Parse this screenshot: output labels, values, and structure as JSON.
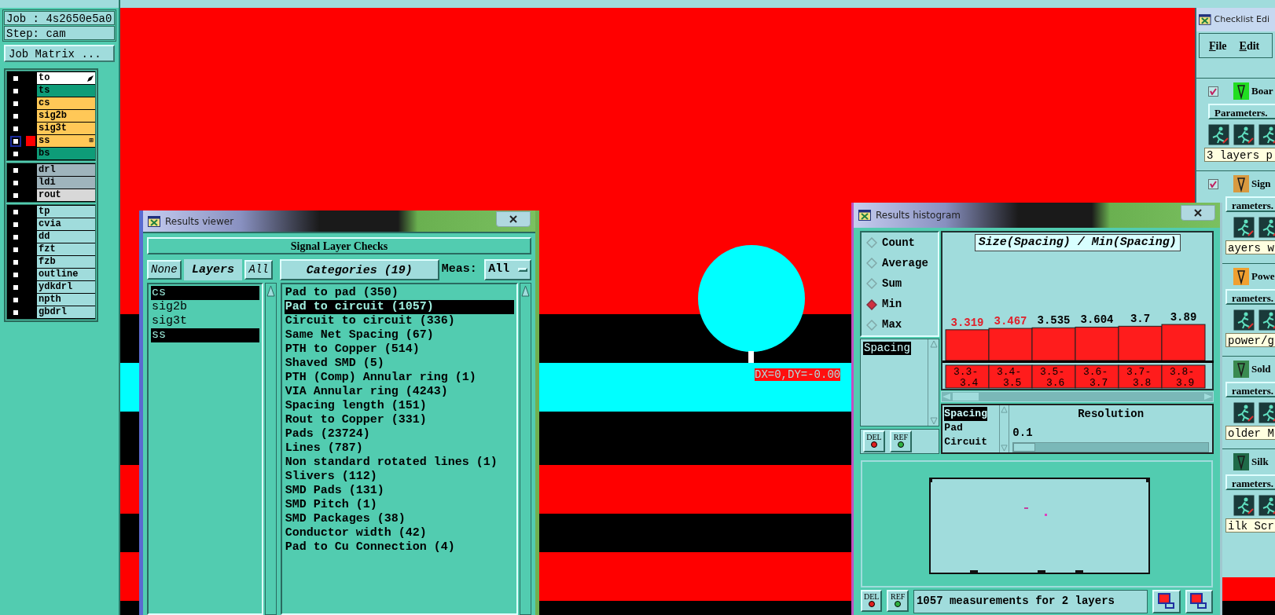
{
  "canvas": {
    "readout": "DX=0,DY=-0.00"
  },
  "job_panel": {
    "job": "Job : 4s2650e5a0",
    "step": "Step: cam",
    "matrix_button": "Job Matrix ...",
    "layer_groups": [
      {
        "layers": [
          {
            "name": "to",
            "color": "#ffffff",
            "checked": false,
            "active": false,
            "work_layer": true
          },
          {
            "name": "ts",
            "color": "#0e9c78",
            "checked": false,
            "active": false,
            "work_layer": false
          },
          {
            "name": "cs",
            "color": "#ffc857",
            "checked": false,
            "active": false,
            "work_layer": false
          },
          {
            "name": "sig2b",
            "color": "#ffc857",
            "checked": false,
            "active": false,
            "work_layer": false
          },
          {
            "name": "sig3t",
            "color": "#ffc857",
            "checked": false,
            "active": false,
            "work_layer": false
          },
          {
            "name": "ss",
            "color": "#ffc857",
            "checked": false,
            "active": true,
            "work_layer": false,
            "marker": "⊞"
          },
          {
            "name": "bs",
            "color": "#0e9c78",
            "checked": false,
            "active": false,
            "work_layer": false
          }
        ]
      },
      {
        "layers": [
          {
            "name": "drl",
            "color": "#9fb4bc",
            "checked": false,
            "active": false,
            "work_layer": false
          },
          {
            "name": "ldi",
            "color": "#9fb4bc",
            "checked": false,
            "active": false,
            "work_layer": false
          },
          {
            "name": "rout",
            "color": "#d8d8d8",
            "checked": false,
            "active": false,
            "work_layer": false
          }
        ]
      },
      {
        "layers": [
          {
            "name": "tp",
            "color": "#a0dcdc",
            "checked": false,
            "active": false,
            "work_layer": false
          },
          {
            "name": "cvia",
            "color": "#a0dcdc",
            "checked": false,
            "active": false,
            "work_layer": false
          },
          {
            "name": "dd",
            "color": "#a0dcdc",
            "checked": false,
            "active": false,
            "work_layer": false
          },
          {
            "name": "fzt",
            "color": "#a0dcdc",
            "checked": false,
            "active": false,
            "work_layer": false
          },
          {
            "name": "fzb",
            "color": "#a0dcdc",
            "checked": false,
            "active": false,
            "work_layer": false
          },
          {
            "name": "outline",
            "color": "#a0dcdc",
            "checked": false,
            "active": false,
            "work_layer": false
          },
          {
            "name": "ydkdrl",
            "color": "#a0dcdc",
            "checked": false,
            "active": false,
            "work_layer": false
          },
          {
            "name": "npth",
            "color": "#a0dcdc",
            "checked": false,
            "active": false,
            "work_layer": false
          },
          {
            "name": "gbdrl",
            "color": "#a0dcdc",
            "checked": false,
            "active": false,
            "work_layer": false
          }
        ]
      }
    ]
  },
  "results_viewer": {
    "title": "Results viewer",
    "heading": "Signal Layer Checks",
    "none_button": "None",
    "layers_label": "Layers",
    "all_button": "All",
    "categories_label": "Categories (19)",
    "meas_label": "Meas:",
    "meas_value": "All",
    "layers": [
      {
        "name": "cs",
        "selected": true
      },
      {
        "name": "sig2b",
        "selected": false
      },
      {
        "name": "sig3t",
        "selected": false
      },
      {
        "name": "ss",
        "selected": true
      }
    ],
    "categories": [
      {
        "label": "Pad to pad (350)",
        "selected": false
      },
      {
        "label": "Pad to circuit (1057)",
        "selected": true
      },
      {
        "label": "Circuit to circuit (336)",
        "selected": false
      },
      {
        "label": "Same Net Spacing (67)",
        "selected": false
      },
      {
        "label": "PTH to Copper (514)",
        "selected": false
      },
      {
        "label": "Shaved SMD (5)",
        "selected": false
      },
      {
        "label": "PTH (Comp) Annular ring (1)",
        "selected": false
      },
      {
        "label": "VIA Annular ring (4243)",
        "selected": false
      },
      {
        "label": "Spacing length (151)",
        "selected": false
      },
      {
        "label": "Rout to Copper (331)",
        "selected": false
      },
      {
        "label": "Pads (23724)",
        "selected": false
      },
      {
        "label": "Lines (787)",
        "selected": false
      },
      {
        "label": "Non standard rotated lines (1)",
        "selected": false
      },
      {
        "label": "Slivers (112)",
        "selected": false
      },
      {
        "label": "SMD Pads (131)",
        "selected": false
      },
      {
        "label": "SMD Pitch (1)",
        "selected": false
      },
      {
        "label": "SMD Packages (38)",
        "selected": false
      },
      {
        "label": "Conductor width (42)",
        "selected": false
      },
      {
        "label": "Pad to Cu Connection (4)",
        "selected": false
      }
    ]
  },
  "histogram": {
    "title": "Results histogram",
    "modes": [
      {
        "label": "Count",
        "selected": false
      },
      {
        "label": "Average",
        "selected": false
      },
      {
        "label": "Sum",
        "selected": false
      },
      {
        "label": "Min",
        "selected": true
      },
      {
        "label": "Max",
        "selected": false
      }
    ],
    "attributes": [
      {
        "label": "Spacing",
        "selected": true
      }
    ],
    "del_button": "DEL",
    "ref_button": "REF",
    "chart_data": {
      "type": "bar",
      "title": "Size(Spacing) / Min(Spacing)",
      "categories": [
        "3.3-3.4",
        "3.4-3.5",
        "3.5-3.6",
        "3.6-3.7",
        "3.7-3.8",
        "3.8-3.9"
      ],
      "values": [
        3.319,
        3.467,
        3.535,
        3.604,
        3.7,
        3.89
      ],
      "data_labels": true
    },
    "highlighted_labels": [
      true,
      true,
      false,
      false,
      false,
      false
    ],
    "measures": [
      {
        "label": "Spacing",
        "selected": true
      },
      {
        "label": "Pad",
        "selected": false
      },
      {
        "label": "Circuit",
        "selected": false
      }
    ],
    "resolution": {
      "label": "Resolution",
      "value": "0.1",
      "level": 0
    },
    "status": "1057 measurements for 2 layers",
    "status_del": "DEL",
    "status_ref": "REF"
  },
  "checklist": {
    "title": "Checklist Edi",
    "menu": [
      "File",
      "Edit"
    ],
    "items": [
      {
        "name": "Boar",
        "checked": true,
        "color": "#22dd22",
        "parameters": "Parameters.",
        "description": "3 layers p"
      },
      {
        "name": "Sign",
        "checked": true,
        "color": "#d89a40",
        "parameters": "rameters.",
        "description": "ayers w"
      },
      {
        "name": "Powe",
        "color": "#f0a030",
        "parameters": "rameters.",
        "description": "power/g"
      },
      {
        "name": "Sold",
        "color": "#3a8a50",
        "parameters": "rameters.",
        "description": "older M"
      },
      {
        "name": "Silk",
        "color": "#1f6a48",
        "parameters": "rameters.",
        "description": "ilk Scr"
      }
    ]
  }
}
